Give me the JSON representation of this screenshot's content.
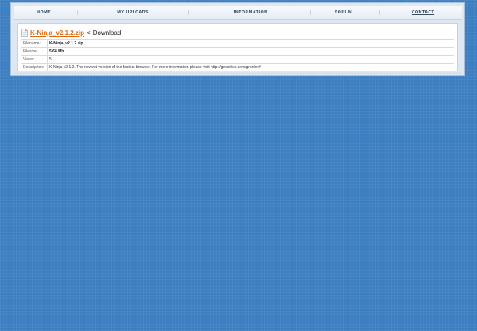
{
  "nav": {
    "items": [
      {
        "label": "HOME",
        "underline": false
      },
      {
        "label": "MY UPLOADS",
        "underline": false
      },
      {
        "label": "INFORMATION",
        "underline": false
      },
      {
        "label": "FORUM",
        "underline": false
      },
      {
        "label": "CONTACT",
        "underline": true
      }
    ]
  },
  "file": {
    "link_text": "K-Ninja_v2.1.2.zip",
    "separator": "<",
    "download_label": "Download",
    "icon": "file-icon"
  },
  "details": {
    "filename_label": "Filename:",
    "filename_value": "K-Ninja_v2.1.2.zip",
    "filesize_label": "Filesize:",
    "filesize_value": "5.68 Mb",
    "views_label": "Views:",
    "views_value": "5",
    "description_label": "Description:",
    "description_value": "K-Ninja v2.1.2. The newest version of the fastest browser. For more information please visit http://geocities.com/grenleef"
  },
  "colors": {
    "background": "#3d7fc0",
    "link": "#e06a10"
  }
}
